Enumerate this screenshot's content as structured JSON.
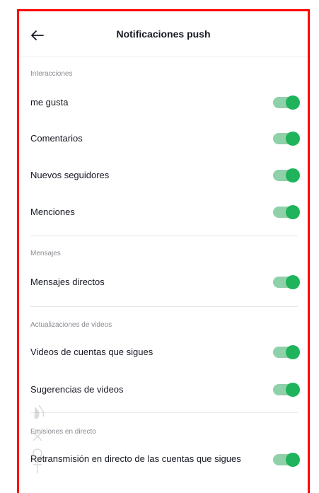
{
  "header": {
    "title": "Notificaciones push",
    "back_icon": "arrow-left-icon"
  },
  "sections": [
    {
      "label": "Interacciones",
      "items": [
        {
          "label": "me gusta",
          "enabled": true
        },
        {
          "label": "Comentarios",
          "enabled": true
        },
        {
          "label": "Nuevos seguidores",
          "enabled": true
        },
        {
          "label": "Menciones",
          "enabled": true
        }
      ]
    },
    {
      "label": "Mensajes",
      "items": [
        {
          "label": "Mensajes directos",
          "enabled": true
        }
      ]
    },
    {
      "label": "Actualizaciones de videos",
      "items": [
        {
          "label": "Videos de cuentas que sigues",
          "enabled": true
        },
        {
          "label": "Sugerencias de videos",
          "enabled": true
        }
      ]
    },
    {
      "label": "Emisiones en directo",
      "items": [
        {
          "label": "Retransmisión en directo de las cuentas que sigues",
          "enabled": true
        }
      ]
    }
  ],
  "colors": {
    "frame_border": "#ff0000",
    "toggle_on_track": "#8fd1a8",
    "toggle_on_knob": "#1fb35b",
    "section_label": "#8a8b91"
  }
}
